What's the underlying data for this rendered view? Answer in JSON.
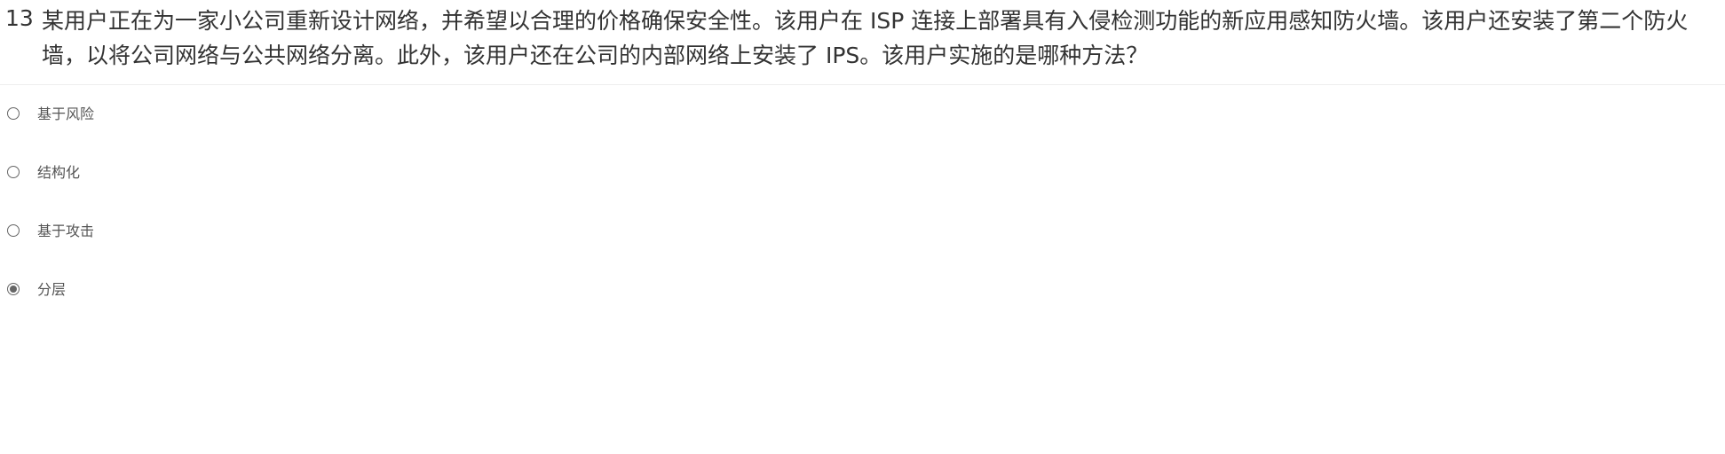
{
  "question": {
    "number": "13",
    "text": "某用户正在为一家小公司重新设计网络，并希望以合理的价格确保安全性。该用户在 ISP 连接上部署具有入侵检测功能的新应用感知防火墙。该用户还安装了第二个防火墙，以将公司网络与公共网络分离。此外，该用户还在公司的内部网络上安装了 IPS。该用户实施的是哪种方法？"
  },
  "options": [
    {
      "label": "基于风险",
      "selected": false
    },
    {
      "label": "结构化",
      "selected": false
    },
    {
      "label": "基于攻击",
      "selected": false
    },
    {
      "label": "分层",
      "selected": true
    }
  ]
}
